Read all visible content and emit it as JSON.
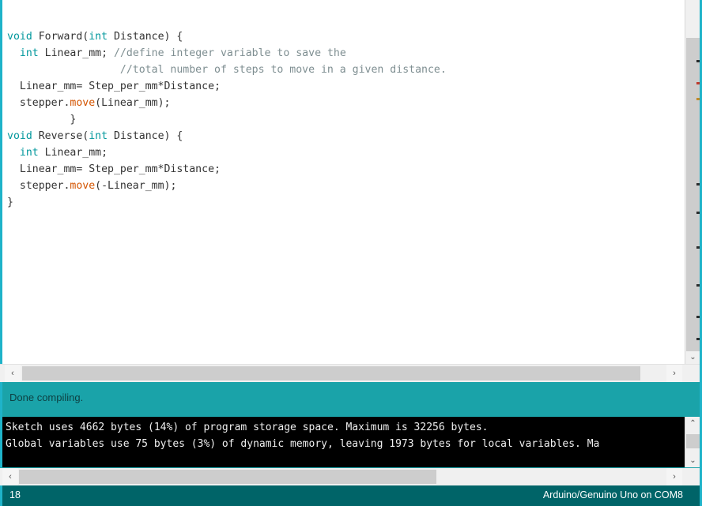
{
  "editor": {
    "name": "arduino-code-editor",
    "lines": [
      {
        "tokens": [
          {
            "t": "kw",
            "s": "void"
          },
          {
            "t": "plain",
            "s": " Forward("
          },
          {
            "t": "kw",
            "s": "int"
          },
          {
            "t": "plain",
            "s": " Distance) {"
          }
        ]
      },
      {
        "tokens": [
          {
            "t": "plain",
            "s": "  "
          },
          {
            "t": "kw",
            "s": "int"
          },
          {
            "t": "plain",
            "s": " Linear_mm; "
          },
          {
            "t": "cmt",
            "s": "//define integer variable to save the"
          }
        ]
      },
      {
        "tokens": [
          {
            "t": "cmt",
            "s": "                  //total number of steps to move in a given distance."
          }
        ]
      },
      {
        "tokens": [
          {
            "t": "plain",
            "s": "  Linear_mm= Step_per_mm*Distance;"
          }
        ]
      },
      {
        "tokens": [
          {
            "t": "plain",
            "s": "  stepper."
          },
          {
            "t": "fn",
            "s": "move"
          },
          {
            "t": "plain",
            "s": "(Linear_mm);"
          }
        ]
      },
      {
        "tokens": [
          {
            "t": "plain",
            "s": "          }"
          }
        ]
      },
      {
        "tokens": [
          {
            "t": "kw",
            "s": "void"
          },
          {
            "t": "plain",
            "s": " Reverse("
          },
          {
            "t": "kw",
            "s": "int"
          },
          {
            "t": "plain",
            "s": " Distance) {"
          }
        ]
      },
      {
        "tokens": [
          {
            "t": "plain",
            "s": "  "
          },
          {
            "t": "kw",
            "s": "int"
          },
          {
            "t": "plain",
            "s": " Linear_mm;"
          }
        ]
      },
      {
        "tokens": [
          {
            "t": "plain",
            "s": "  Linear_mm= Step_per_mm*Distance;"
          }
        ]
      },
      {
        "tokens": [
          {
            "t": "plain",
            "s": "  stepper."
          },
          {
            "t": "fn",
            "s": "move"
          },
          {
            "t": "plain",
            "s": "(-Linear_mm);"
          }
        ]
      },
      {
        "tokens": [
          {
            "t": "plain",
            "s": "}"
          }
        ]
      }
    ]
  },
  "status": {
    "message": "Done compiling."
  },
  "console": {
    "lines": [
      "Sketch uses 4662 bytes (14%) of program storage space. Maximum is 32256 bytes.",
      "Global variables use 75 bytes (3%) of dynamic memory, leaving 1973 bytes for local variables. Ma"
    ]
  },
  "bottom_bar": {
    "line_number": "18",
    "board_info": "Arduino/Genuino Uno on COM8"
  },
  "scrollbars": {
    "editor_vertical_arrow_down": "⌄",
    "editor_horizontal_arrow_left": "‹",
    "editor_horizontal_arrow_right": "›",
    "console_vertical_arrow_up": "⌃",
    "console_vertical_arrow_down": "⌄",
    "console_horizontal_arrow_left": "‹",
    "console_horizontal_arrow_right": "›"
  },
  "colors": {
    "accent_teal": "#1aa3a9",
    "border_cyan": "#1fb3c9",
    "bottom_bar": "#006468",
    "keyword": "#00979c",
    "function": "#d35400",
    "comment": "#7e8e91",
    "code_text": "#333333",
    "console_bg": "#000000",
    "console_text": "#eeeeee"
  }
}
